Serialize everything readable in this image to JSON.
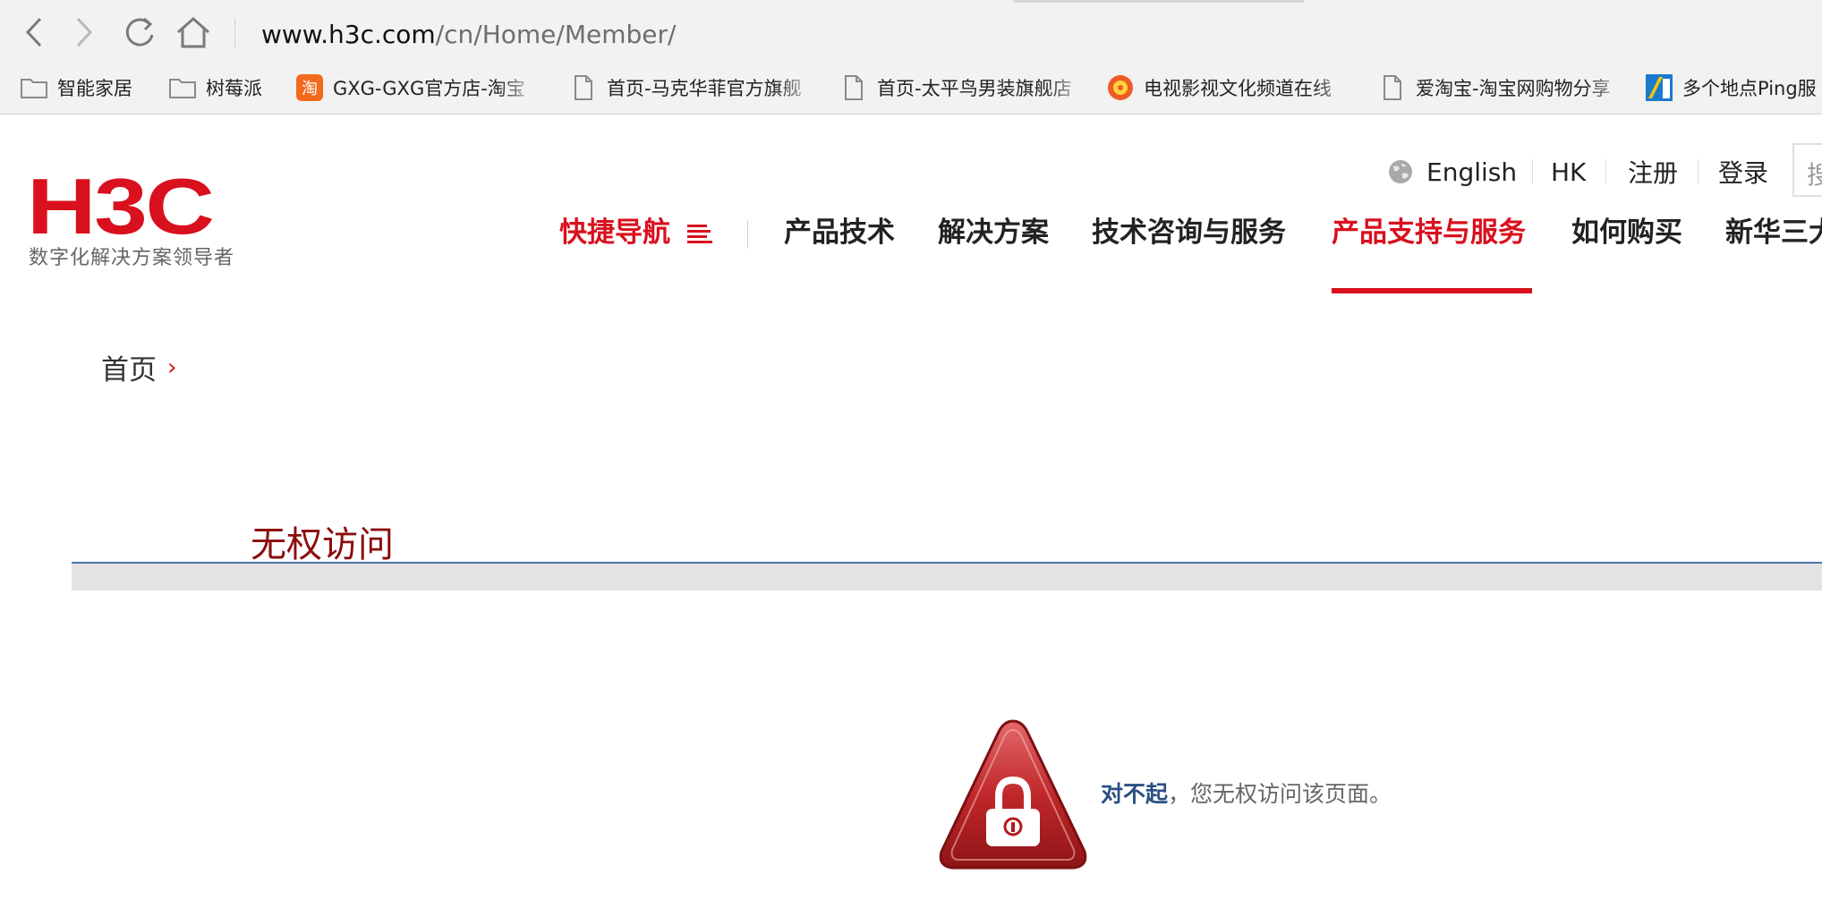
{
  "browser": {
    "url_host": "www.h3c.com",
    "url_path": "/cn/Home/Member/",
    "bookmarks": [
      {
        "label": "智能家居",
        "icon": "folder-icon"
      },
      {
        "label": "树莓派",
        "icon": "folder-icon"
      },
      {
        "label": "GXG-GXG官方店-淘宝",
        "icon": "taobao-icon"
      },
      {
        "label": "首页-马克华菲官方旗舰",
        "icon": "page-icon"
      },
      {
        "label": "首页-太平鸟男装旗舰店",
        "icon": "page-icon"
      },
      {
        "label": "电视影视文化频道在线",
        "icon": "tv-channel-icon"
      },
      {
        "label": "爱淘宝-淘宝网购物分享",
        "icon": "page-icon"
      },
      {
        "label": "多个地点Ping服",
        "icon": "ping-site-icon"
      }
    ]
  },
  "header": {
    "logo_mark": "H3C",
    "logo_tagline": "数字化解决方案领导者",
    "util": {
      "language": "English",
      "region": "HK",
      "register": "注册",
      "login": "登录",
      "search_placeholder": "搜"
    },
    "nav": {
      "quick_nav": "快捷导航",
      "items": [
        "产品技术",
        "解决方案",
        "技术咨询与服务",
        "产品支持与服务",
        "如何购买",
        "新华三大"
      ],
      "active_index": 3
    }
  },
  "breadcrumb": {
    "home": "首页",
    "separator": "›"
  },
  "content": {
    "title": "无权访问",
    "message_strong": "对不起",
    "message_rest": "，您无权访问该页面。"
  },
  "colors": {
    "brand_red": "#d9101e",
    "title_red": "#8b0c0c",
    "message_blue": "#2a4f82"
  }
}
